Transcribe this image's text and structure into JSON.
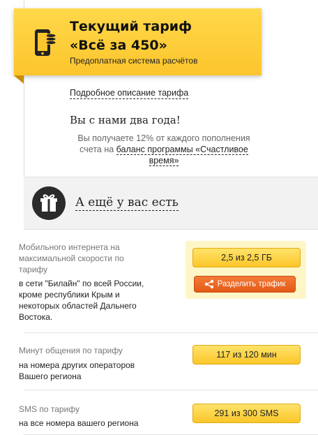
{
  "header": {
    "title": "Текущий тариф",
    "tariff_name": "«Всё за 450»",
    "subtitle": "Предоплатная система расчётов"
  },
  "info": {
    "description_link": "Подробное описание тарифа",
    "loyalty": "Вы с нами два года!",
    "bonus_prefix": "Вы получаете 12% от каждого пополнения счета на",
    "bonus_link": "баланс программы «Счастливое время»"
  },
  "extras": {
    "title": "А ещё у вас есть"
  },
  "rows": [
    {
      "label": "Мобильного интернета на максимальной скорости по тарифу",
      "desc": "в сети \"Билайн\" по всей России, кроме республики Крым и некоторых областей Дальнего Востока.",
      "value": "2,5 из 2,5 ГБ",
      "used_fraction": 1.0
    },
    {
      "label": "Минут общения по тарифу",
      "desc": "на номера других операторов Вашего региона",
      "value": "117 из 120 мин",
      "used_fraction": 0.975
    },
    {
      "label": "SMS по тарифу",
      "desc": "на все номера вашего региона",
      "value": "291 из 300 SMS",
      "used_fraction": 0.97
    }
  ],
  "share_button": "Разделить трафик",
  "colors": {
    "accent_yellow": "#fcc52d",
    "share_orange": "#e45a16",
    "band_gray": "#f2f2f2"
  },
  "icons": [
    "phone-icon",
    "gift-icon",
    "share-icon"
  ]
}
